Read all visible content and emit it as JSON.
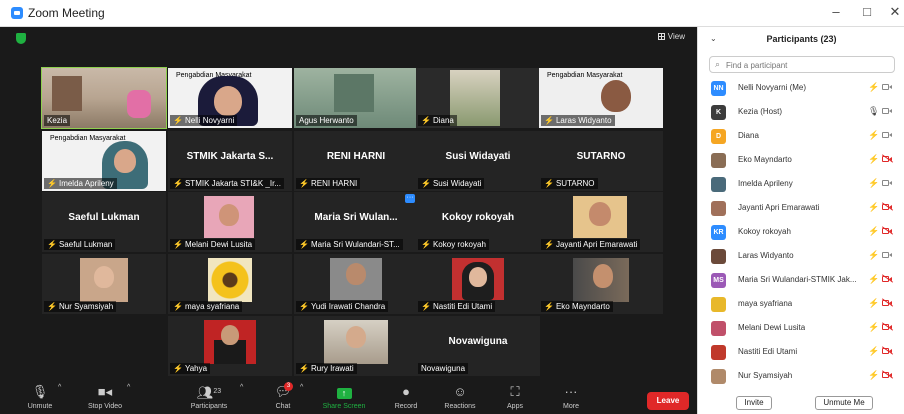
{
  "window": {
    "title": "Zoom Meeting",
    "minimize": "–",
    "maximize": "□",
    "close": "✕"
  },
  "video": {
    "view_label": "View",
    "tiles": [
      {
        "label": "Kezia",
        "name": "",
        "muted": false
      },
      {
        "label": "Nelli  Novyarni",
        "name": "",
        "muted": true,
        "banner": "Pengabdian Masyarakat"
      },
      {
        "label": "Agus Herwanto",
        "name": "",
        "muted": false
      },
      {
        "label": "Diana",
        "name": "",
        "muted": true
      },
      {
        "label": "Laras Widyanto",
        "name": "",
        "muted": true,
        "banner": "Pengabdian Masyarakat"
      },
      {
        "label": "Imelda Aprileny",
        "name": "",
        "muted": true,
        "banner": "Pengabdian Masyarakat"
      },
      {
        "label": "STMIK Jakarta STI&K _Ir...",
        "name": "STMIK Jakarta S...",
        "muted": true
      },
      {
        "label": "RENI HARNI",
        "name": "RENI HARNI",
        "muted": true
      },
      {
        "label": "Susi Widayati",
        "name": "Susi Widayati",
        "muted": true
      },
      {
        "label": "SUTARNO",
        "name": "SUTARNO",
        "muted": true
      },
      {
        "label": "Saeful Lukman",
        "name": "Saeful Lukman",
        "muted": true
      },
      {
        "label": "Melani Dewi Lusita",
        "name": "",
        "muted": true
      },
      {
        "label": "Maria Sri Wulandari-ST...",
        "name": "Maria Sri Wulan...",
        "muted": true
      },
      {
        "label": "Kokoy rokoyah",
        "name": "Kokoy rokoyah",
        "muted": true
      },
      {
        "label": "Jayanti Apri Emarawati",
        "name": "",
        "muted": true
      },
      {
        "label": "Nur Syamsiyah",
        "name": "",
        "muted": true
      },
      {
        "label": "maya syafriana",
        "name": "",
        "muted": true
      },
      {
        "label": "Yudi Irawati Chandra",
        "name": "",
        "muted": true
      },
      {
        "label": "Nastiti Edi Utami",
        "name": "",
        "muted": true
      },
      {
        "label": "Eko Mayndarto",
        "name": "",
        "muted": true
      },
      {
        "label": "Yahya",
        "name": "",
        "muted": true
      },
      {
        "label": "Rury Irawati",
        "name": "",
        "muted": true
      },
      {
        "label": "Novawiguna",
        "name": "Novawiguna",
        "muted": false
      }
    ]
  },
  "toolbar": {
    "unmute": "Unmute",
    "stop_video": "Stop Video",
    "participants": "Participants",
    "participants_count": "23",
    "chat": "Chat",
    "chat_badge": "3",
    "share_screen": "Share Screen",
    "record": "Record",
    "reactions": "Reactions",
    "apps": "Apps",
    "more": "More",
    "leave": "Leave"
  },
  "panel": {
    "title": "Participants (23)",
    "search_placeholder": "Find a participant",
    "invite": "Invite",
    "unmute_me": "Unmute Me",
    "participants": [
      {
        "name": "Nelli  Novyarni (Me)",
        "initials": "NN",
        "color": "#2d8cff",
        "mic_on": false,
        "cam_on": true
      },
      {
        "name": "Kezia (Host)",
        "initials": "K",
        "color": "#3c3c3c",
        "mic_on": true,
        "cam_on": true
      },
      {
        "name": "Diana",
        "initials": "D",
        "color": "#f5a623",
        "mic_on": false,
        "cam_on": true
      },
      {
        "name": "Eko Mayndarto",
        "initials": "",
        "color": "#8a6d55",
        "mic_on": false,
        "cam_on": false
      },
      {
        "name": "Imelda Aprileny",
        "initials": "",
        "color": "#4a6a7a",
        "mic_on": false,
        "cam_on": true
      },
      {
        "name": "Jayanti Apri Emarawati",
        "initials": "",
        "color": "#a0705a",
        "mic_on": false,
        "cam_on": false
      },
      {
        "name": "Kokoy rokoyah",
        "initials": "KR",
        "color": "#2d8cff",
        "mic_on": false,
        "cam_on": false
      },
      {
        "name": "Laras Widyanto",
        "initials": "",
        "color": "#6b4a3a",
        "mic_on": false,
        "cam_on": true
      },
      {
        "name": "Maria Sri Wulandari-STMIK Jak...",
        "initials": "MS",
        "color": "#9b59b6",
        "mic_on": false,
        "cam_on": false
      },
      {
        "name": "maya syafriana",
        "initials": "",
        "color": "#e8b82a",
        "mic_on": false,
        "cam_on": false
      },
      {
        "name": "Melani Dewi Lusita",
        "initials": "",
        "color": "#c0506a",
        "mic_on": false,
        "cam_on": false
      },
      {
        "name": "Nastiti Edi Utami",
        "initials": "",
        "color": "#c0392b",
        "mic_on": false,
        "cam_on": false
      },
      {
        "name": "Nur Syamsiyah",
        "initials": "",
        "color": "#b08a6a",
        "mic_on": false,
        "cam_on": false
      }
    ]
  }
}
